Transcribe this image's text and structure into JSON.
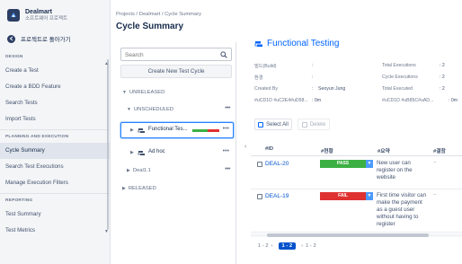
{
  "sidebar": {
    "project_name": "Dealmart",
    "project_sub": "소프트웨어 프로젝트",
    "back_label": "프로젝트로 돌아가기",
    "sections": [
      {
        "title": "DESIGN",
        "items": [
          "Create a Test",
          "Create a BDD Feature",
          "Search Tests",
          "Import Tests"
        ]
      },
      {
        "title": "PLANNING AND EXECUTION",
        "items": [
          "Cycle Summary",
          "Search Test Executions",
          "Manage Execution Filters"
        ]
      },
      {
        "title": "REPORTING",
        "items": [
          "Test Summary",
          "Test Metrics"
        ]
      }
    ],
    "active_item": "Cycle Summary"
  },
  "header": {
    "breadcrumb": "Projects  /  Dealmart  /  Cycle Summary",
    "title": "Cycle Summary"
  },
  "tree": {
    "search_placeholder": "Search",
    "create_label": "Create New Test Cycle",
    "unreleased": "UNRELEASED",
    "unscheduled": "UNSCHEDULED",
    "functional_label": "Functional Tes...",
    "functional_progress": {
      "pass": 0.55,
      "fail": 0.45
    },
    "adhoc_label": "Ad hoc",
    "deal_label": "Deal1.1",
    "released": "RELEASED"
  },
  "detail": {
    "title": "Functional Testing",
    "info": {
      "build_label": "빌드(Build)",
      "build_value": ":",
      "env_label": "환경",
      "env_value": ":",
      "created_by_label": "Created By",
      "created_by_value": "Seoyun Jung",
      "created_sep": ":",
      "extra_left_label": "#uCD1D #uC2E4#uD58...",
      "extra_left_value": ": 0m",
      "total_exec_label": "Total Executions",
      "total_exec_value": ": 2",
      "cycle_exec_label": "Cycle Executions",
      "cycle_exec_value": ": 2",
      "total_executed_label": "Total Executed",
      "total_executed_value": ": 2",
      "extra_right_label": "#uCD1D #uB85C#uAD...",
      "extra_right_value": ": 0m"
    },
    "select_all": "Select All",
    "delete": "Delete",
    "columns": [
      "#ID",
      "#현황",
      "#요약",
      "#결함"
    ],
    "rows": [
      {
        "id": "DEAL-20",
        "status": "PASS",
        "status_color": "#3cb043",
        "summary": "New user can register on the website",
        "defects": "–"
      },
      {
        "id": "DEAL-19",
        "status": "FAIL",
        "status_color": "#e03131",
        "summary": "First time visitor can make the payment as a guest user without having to register",
        "defects": "–"
      }
    ],
    "pager": {
      "range_left": "1 - 2",
      "current": "1 - 2",
      "range_right": "1 - 2"
    }
  }
}
